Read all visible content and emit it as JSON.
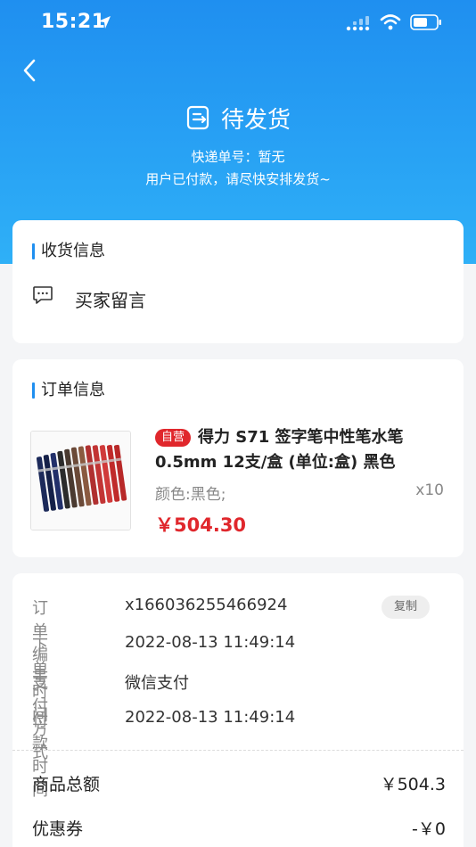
{
  "status_bar": {
    "time": "15:21"
  },
  "header": {
    "title": "待发货",
    "tracking_label": "快递单号：暂无",
    "subtitle": "用户已付款，请尽快安排发货~"
  },
  "shipping": {
    "section_title": "收货信息",
    "buyer_message_label": "买家留言"
  },
  "order": {
    "section_title": "订单信息",
    "product": {
      "badge": "自营",
      "name": "得力 S71 签字笔中性笔水笔 0.5mm 12支/盒 (单位:盒) 黑色",
      "spec": "颜色:黑色;",
      "quantity": "x10",
      "price": "￥504.30"
    }
  },
  "details": {
    "rows": [
      {
        "label": "订单编号",
        "value": "x166036255466924"
      },
      {
        "label": "下单时间",
        "value": "2022-08-13 11:49:14"
      },
      {
        "label": "支付方式",
        "value": "微信支付"
      },
      {
        "label": "付款时间",
        "value": "2022-08-13 11:49:14"
      }
    ],
    "copy_label": "复制",
    "summary": [
      {
        "label": "商品总额",
        "value": "￥504.3"
      },
      {
        "label": "优惠券",
        "value": "-￥0"
      }
    ]
  },
  "colors": {
    "accent": "#1f8ff0",
    "price": "#e0272c"
  }
}
